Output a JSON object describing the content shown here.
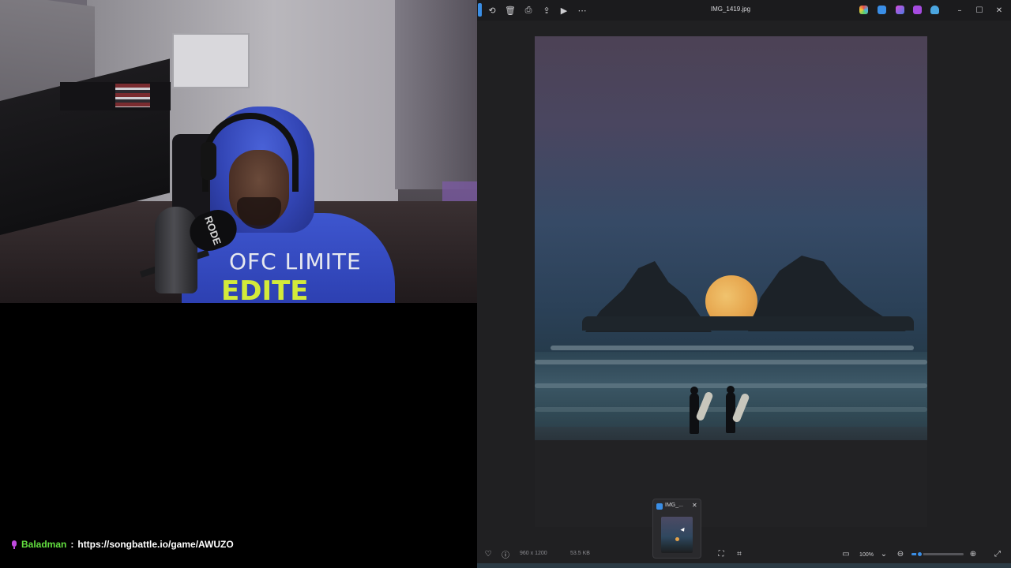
{
  "chat": {
    "user": "Baladman",
    "separator": ":",
    "message": "https://songbattle.io/game/AWUZO",
    "user_color": "#63e040"
  },
  "webcam": {
    "shirt_line1": "OFC LIMITE",
    "shirt_line2": "EDITE",
    "mic_brand": "RODE"
  },
  "viewer": {
    "title": "IMG_1419.jpg",
    "toolbar": {
      "rotate": "rotate-icon",
      "delete": "delete-icon",
      "print": "print-icon",
      "share": "share-icon",
      "slideshow": "slideshow-icon",
      "more": "more-icon"
    },
    "thumbnail": {
      "title": "IMG_...",
      "close": "✕"
    },
    "info": {
      "dimensions": "960 x 1200",
      "size": "53.5 KB"
    },
    "zoom": {
      "value": "100%",
      "slider_level": 0.15
    },
    "colors": {
      "accent": "#3a8ee6",
      "background": "#202022"
    }
  }
}
